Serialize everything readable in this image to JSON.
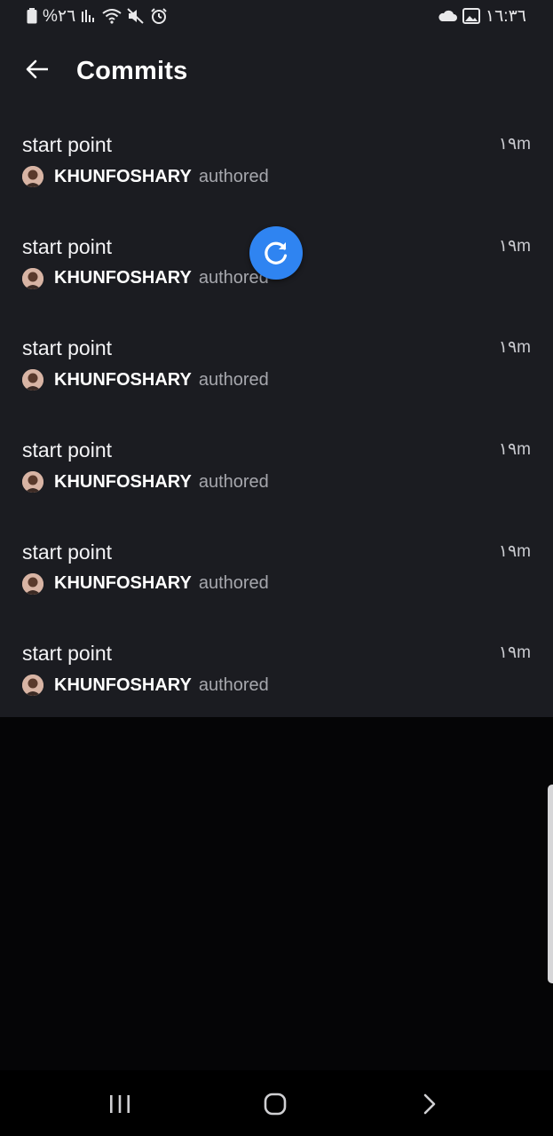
{
  "status_bar": {
    "battery_text": "%٢٦",
    "clock": "١٦:٣٦",
    "left_icons": [
      "battery-icon",
      "signal-icon",
      "wifi-icon",
      "mute-icon",
      "alarm-icon"
    ],
    "right_icons": [
      "cloud-icon",
      "gallery-icon"
    ]
  },
  "header": {
    "title": "Commits",
    "back_icon": "arrow-left-icon"
  },
  "commits": [
    {
      "message": "start point",
      "author": "KHUNFOSHARY",
      "verb": "authored",
      "time": "١٩m"
    },
    {
      "message": "start point",
      "author": "KHUNFOSHARY",
      "verb": "authored",
      "time": "١٩m"
    },
    {
      "message": "start point",
      "author": "KHUNFOSHARY",
      "verb": "authored",
      "time": "١٩m"
    },
    {
      "message": "start point",
      "author": "KHUNFOSHARY",
      "verb": "authored",
      "time": "١٩m"
    },
    {
      "message": "start point",
      "author": "KHUNFOSHARY",
      "verb": "authored",
      "time": "١٩m"
    },
    {
      "message": "start point",
      "author": "KHUNFOSHARY",
      "verb": "authored",
      "time": "١٩m"
    }
  ],
  "refresh": {
    "icon": "refresh-icon",
    "color": "#2f84f1"
  },
  "nav_bar": {
    "icons": [
      "recent-apps-icon",
      "home-icon",
      "back-chevron-icon"
    ]
  },
  "colors": {
    "surface": "#1b1c21",
    "background": "#050506",
    "accent": "#2f84f1",
    "muted_text": "#a6a7ad"
  }
}
